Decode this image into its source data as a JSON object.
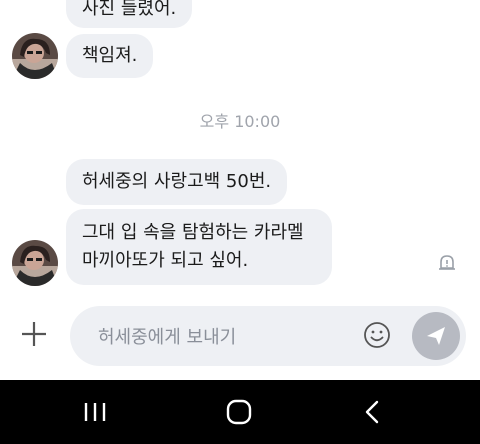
{
  "messages": [
    {
      "text": "사진 들렸어."
    },
    {
      "text": "책임져."
    },
    {
      "text": "허세중의 사랑고백 50번."
    },
    {
      "text": "그대 입 속을 탐험하는 카라멜 마끼아또가 되고 싶어."
    }
  ],
  "timestamp": "오후 10:00",
  "input": {
    "placeholder": "허세중에게 보내기"
  },
  "icons": {
    "avatar": "profile-photo",
    "report": "alert-bell-icon",
    "plus": "plus-icon",
    "emoji": "emoji-icon",
    "send": "send-icon",
    "recents": "recents-icon",
    "home": "home-icon",
    "back": "back-icon"
  },
  "colors": {
    "bubble": "#eef0f4",
    "send_button": "#b7bac2",
    "timestamp": "#a0a4ac",
    "navbar": "#000000"
  }
}
